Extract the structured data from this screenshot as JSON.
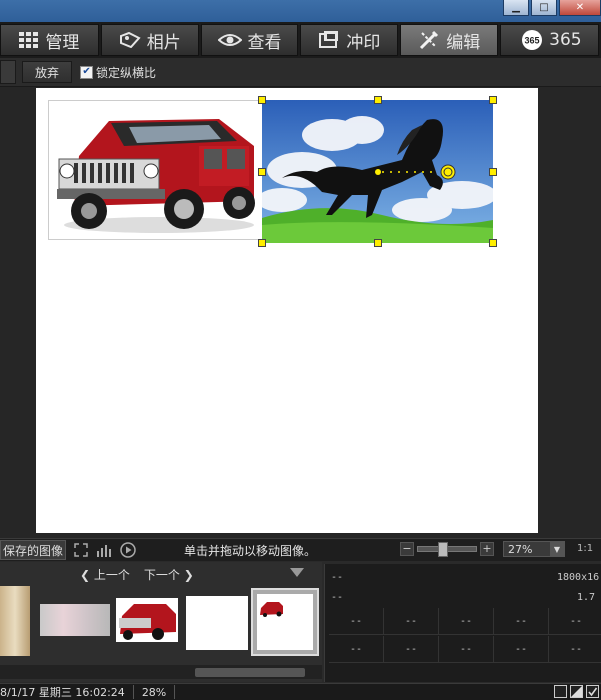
{
  "tabs": [
    {
      "label": "管理",
      "icon": "grid-icon"
    },
    {
      "label": "相片",
      "icon": "photo-tag-icon"
    },
    {
      "label": "查看",
      "icon": "eye-icon"
    },
    {
      "label": "冲印",
      "icon": "print-icon"
    },
    {
      "label": "编辑",
      "icon": "edit-tools-icon",
      "active": true
    },
    {
      "label": "365",
      "icon": "365-badge-icon"
    }
  ],
  "toolbar": {
    "discard_label": "放弃",
    "lock_ratio_label": "锁定纵横比",
    "lock_ratio_checked": true
  },
  "status": {
    "saved_images_label": "保存的图像",
    "hint": "单击并拖动以移动图像。",
    "zoom_value": "27%",
    "one_to_one": "1:1"
  },
  "filmstrip": {
    "prev_label": "上一个",
    "next_label": "下一个"
  },
  "info": {
    "row1_left": "--",
    "row1_right": "1800x16",
    "row2_left": "--",
    "row2_right": "1.7",
    "cells": [
      "--",
      "--",
      "--",
      "--",
      "--",
      "--",
      "--",
      "--",
      "--",
      "--"
    ]
  },
  "bottom": {
    "datetime": "8/1/17 星期三 16:02:24",
    "zoom": "28%"
  },
  "colors": {
    "accent": "#ffee00",
    "titlebar": "#3d6fa8"
  }
}
